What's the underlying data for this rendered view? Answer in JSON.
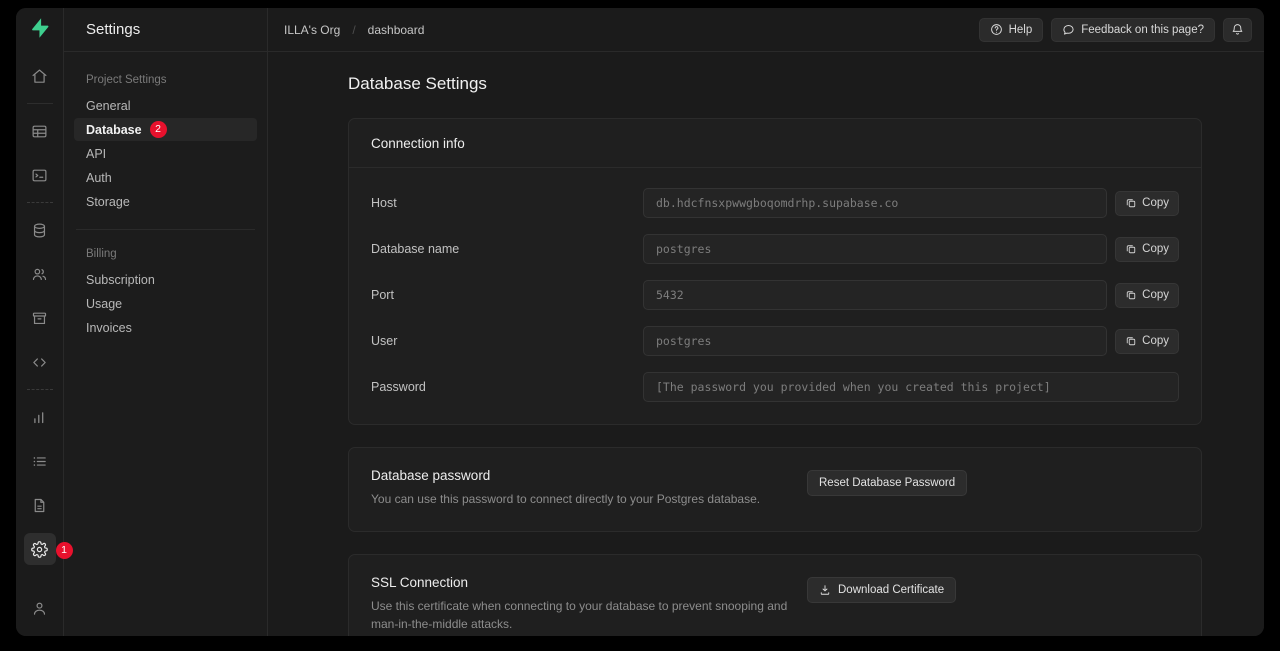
{
  "window": {
    "logo_icon": "supabase-bolt-logo"
  },
  "rail": {
    "items": [
      {
        "icon": "home-icon",
        "name": "home"
      },
      {
        "icon": "table-icon",
        "name": "table-editor"
      },
      {
        "icon": "terminal-icon",
        "name": "sql-editor"
      },
      {
        "icon": "database-icon",
        "name": "database"
      },
      {
        "icon": "users-icon",
        "name": "authentication"
      },
      {
        "icon": "archive-icon",
        "name": "storage"
      },
      {
        "icon": "code-icon",
        "name": "api-docs"
      },
      {
        "icon": "bar-chart-icon",
        "name": "reports"
      },
      {
        "icon": "list-icon",
        "name": "logs"
      },
      {
        "icon": "document-icon",
        "name": "docs"
      },
      {
        "icon": "gear-icon",
        "name": "settings"
      }
    ],
    "settings_badge": "1",
    "bottom_icon": "user-icon"
  },
  "nav": {
    "title": "Settings",
    "group1_label": "Project Settings",
    "group1_items": [
      {
        "label": "General",
        "active": false
      },
      {
        "label": "Database",
        "active": true,
        "badge": "2"
      },
      {
        "label": "API",
        "active": false
      },
      {
        "label": "Auth",
        "active": false
      },
      {
        "label": "Storage",
        "active": false
      }
    ],
    "group2_label": "Billing",
    "group2_items": [
      {
        "label": "Subscription"
      },
      {
        "label": "Usage"
      },
      {
        "label": "Invoices"
      }
    ]
  },
  "topbar": {
    "breadcrumb_org": "ILLA's Org",
    "breadcrumb_sep": "/",
    "breadcrumb_project": "dashboard",
    "help_label": "Help",
    "help_icon": "question-circle-icon",
    "feedback_label": "Feedback on this page?",
    "feedback_icon": "chat-bubble-icon",
    "notifications_icon": "bell-icon"
  },
  "page": {
    "title": "Database Settings"
  },
  "connection_card": {
    "heading": "Connection info",
    "copy_label": "Copy",
    "copy_icon": "copy-icon",
    "fields": [
      {
        "label": "Host",
        "value": "db.hdcfnsxpwwgboqomdrhp.supabase.co",
        "has_copy": true
      },
      {
        "label": "Database name",
        "value": "postgres",
        "has_copy": true
      },
      {
        "label": "Port",
        "value": "5432",
        "has_copy": true
      },
      {
        "label": "User",
        "value": "postgres",
        "has_copy": true
      },
      {
        "label": "Password",
        "value": "[The password you provided when you created this project]",
        "has_copy": false
      }
    ]
  },
  "password_card": {
    "title": "Database password",
    "description": "You can use this password to connect directly to your Postgres database.",
    "button_label": "Reset Database Password"
  },
  "ssl_card": {
    "title": "SSL Connection",
    "description": "Use this certificate when connecting to your database to prevent snooping and man-in-the-middle attacks.",
    "button_label": "Download Certificate",
    "button_icon": "download-icon"
  },
  "colors": {
    "page_bg": "#1b1b1b",
    "card_bg": "#1f1f1f",
    "accent_green": "#3ecf8e",
    "badge_red": "#e8112d",
    "border": "#2b2b2b"
  }
}
